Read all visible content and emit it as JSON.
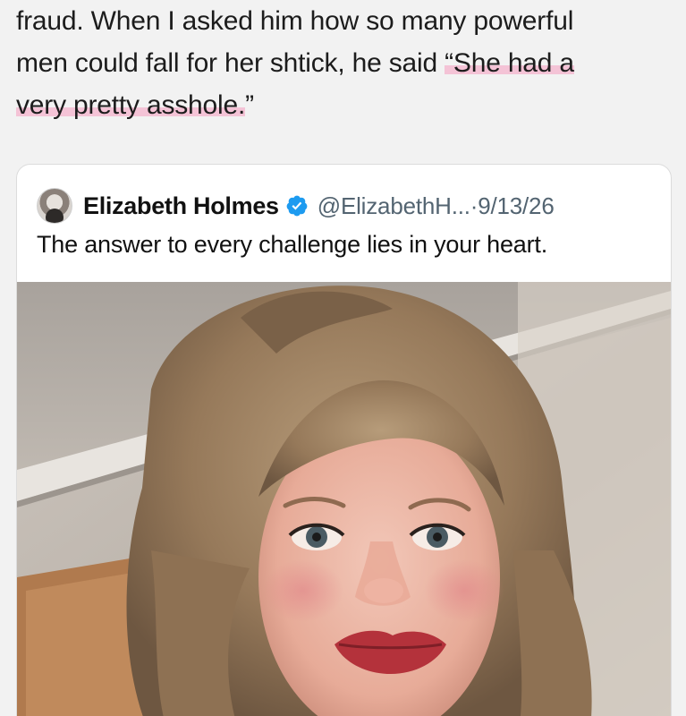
{
  "article": {
    "line1": "fraud. When I asked him how so many powerful",
    "line2_plain": "men could fall for her shtick, he said ",
    "line2_highlight": "“She had a",
    "line3_highlight": "very pretty asshole.",
    "line3_plain": "”"
  },
  "tweet": {
    "author_name": "Elizabeth Holmes",
    "handle": "@ElizabethH...",
    "separator": "·",
    "date": "9/13/26",
    "text": "The answer to every challenge lies in your heart.",
    "verified_color": "#1d9bf0"
  },
  "icons": {
    "verified": "verified-badge-icon",
    "avatar": "profile-avatar"
  }
}
